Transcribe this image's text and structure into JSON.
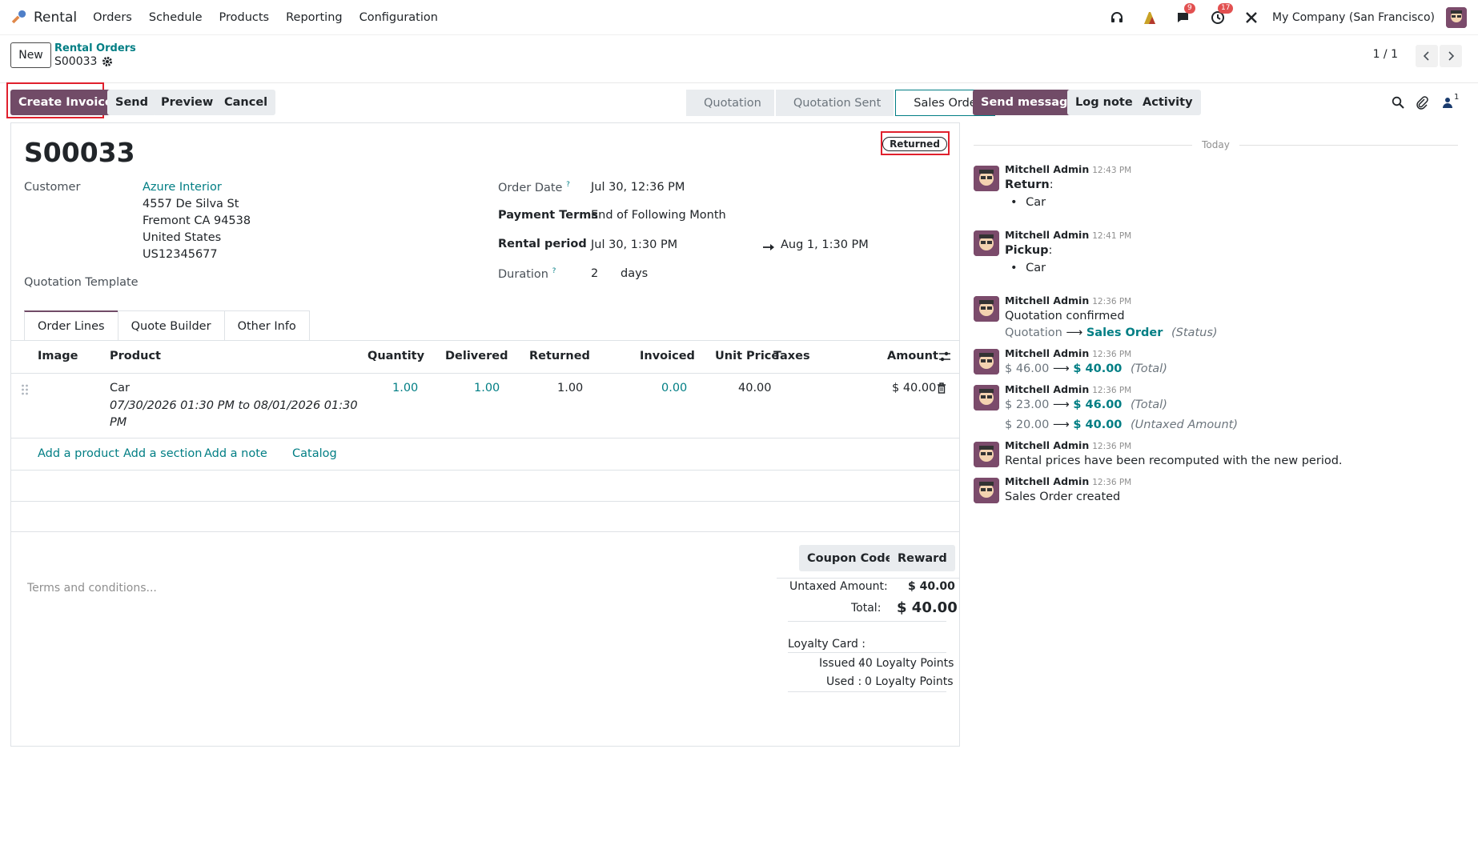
{
  "app": {
    "name": "Rental"
  },
  "nav": {
    "menu": [
      "Orders",
      "Schedule",
      "Products",
      "Reporting",
      "Configuration"
    ],
    "messages_count": "9",
    "activities_count": "17",
    "company": "My Company (San Francisco)"
  },
  "control": {
    "new_label": "New",
    "breadcrumb_parent": "Rental Orders",
    "breadcrumb_current": "S00033",
    "pager": "1 / 1"
  },
  "actions": {
    "create_invoice": "Create Invoice",
    "send": "Send",
    "preview": "Preview",
    "cancel": "Cancel"
  },
  "status": {
    "stages": [
      "Quotation",
      "Quotation Sent",
      "Sales Order"
    ],
    "active": "Sales Order"
  },
  "form": {
    "title": "S00033",
    "ribbon": "Returned",
    "customer_label": "Customer",
    "customer_name": "Azure Interior",
    "address": [
      "4557 De Silva St",
      "Fremont CA 94538",
      "United States",
      "US12345677"
    ],
    "quotation_template_label": "Quotation Template",
    "order_date_label": "Order Date",
    "order_date": "Jul 30, 12:36 PM",
    "payment_terms_label": "Payment Terms",
    "payment_terms": "End of Following Month",
    "rental_period_label": "Rental period",
    "rental_start": "Jul 30, 1:30 PM",
    "rental_end": "Aug 1, 1:30 PM",
    "duration_label": "Duration",
    "duration_value": "2",
    "duration_unit": "days",
    "help_mark": "?"
  },
  "tabs": [
    "Order Lines",
    "Quote Builder",
    "Other Info"
  ],
  "table": {
    "headers": {
      "image": "Image",
      "product": "Product",
      "quantity": "Quantity",
      "delivered": "Delivered",
      "returned": "Returned",
      "invoiced": "Invoiced",
      "unit_price": "Unit Price",
      "taxes": "Taxes",
      "amount": "Amount"
    },
    "row": {
      "product": "Car",
      "description_line1": "07/30/2026 01:30 PM to 08/01/2026 01:30",
      "description_line2": "PM",
      "quantity": "1.00",
      "delivered": "1.00",
      "returned": "1.00",
      "invoiced": "0.00",
      "unit_price": "40.00",
      "amount": "$ 40.00"
    },
    "add_links": [
      "Add a product",
      "Add a section",
      "Add a note",
      "Catalog"
    ]
  },
  "footer": {
    "terms_placeholder": "Terms and conditions...",
    "coupon_button": "Coupon Code",
    "reward_button": "Reward",
    "untaxed_label": "Untaxed Amount:",
    "untaxed_value": "$ 40.00",
    "total_label": "Total:",
    "total_value": "$ 40.00",
    "loyalty_label": "Loyalty Card :",
    "issued_label": "Issued :",
    "issued_value": "40 Loyalty Points",
    "used_label": "Used :",
    "used_value": "0 Loyalty Points"
  },
  "chatter": {
    "send_message": "Send message",
    "log_note": "Log note",
    "activity": "Activity",
    "followers_count": "1",
    "today": "Today",
    "messages": [
      {
        "author": "Mitchell Admin",
        "time": "12:43 PM",
        "bold": "Return",
        "colon": ":",
        "item": "Car"
      },
      {
        "author": "Mitchell Admin",
        "time": "12:41 PM",
        "bold": "Pickup",
        "colon": ":",
        "item": "Car"
      },
      {
        "author": "Mitchell Admin",
        "time": "12:36 PM",
        "text": "Quotation confirmed",
        "from": "Quotation",
        "to": "Sales Order",
        "field": "(Status)"
      },
      {
        "author": "Mitchell Admin",
        "time": "12:36 PM",
        "from": "$ 46.00",
        "to": "$ 40.00",
        "field": "(Total)"
      },
      {
        "author": "Mitchell Admin",
        "time": "12:36 PM",
        "from": "$ 23.00",
        "to": "$ 46.00",
        "field": "(Total)",
        "from2": "$ 20.00",
        "to2": "$ 40.00",
        "field2": "(Untaxed Amount)"
      },
      {
        "author": "Mitchell Admin",
        "time": "12:36 PM",
        "text": "Rental prices have been recomputed with the new period."
      },
      {
        "author": "Mitchell Admin",
        "time": "12:36 PM",
        "text": "Sales Order created"
      }
    ]
  },
  "colors": {
    "brand": "#714b67",
    "link": "#017e84",
    "highlight": "#e0202d"
  }
}
